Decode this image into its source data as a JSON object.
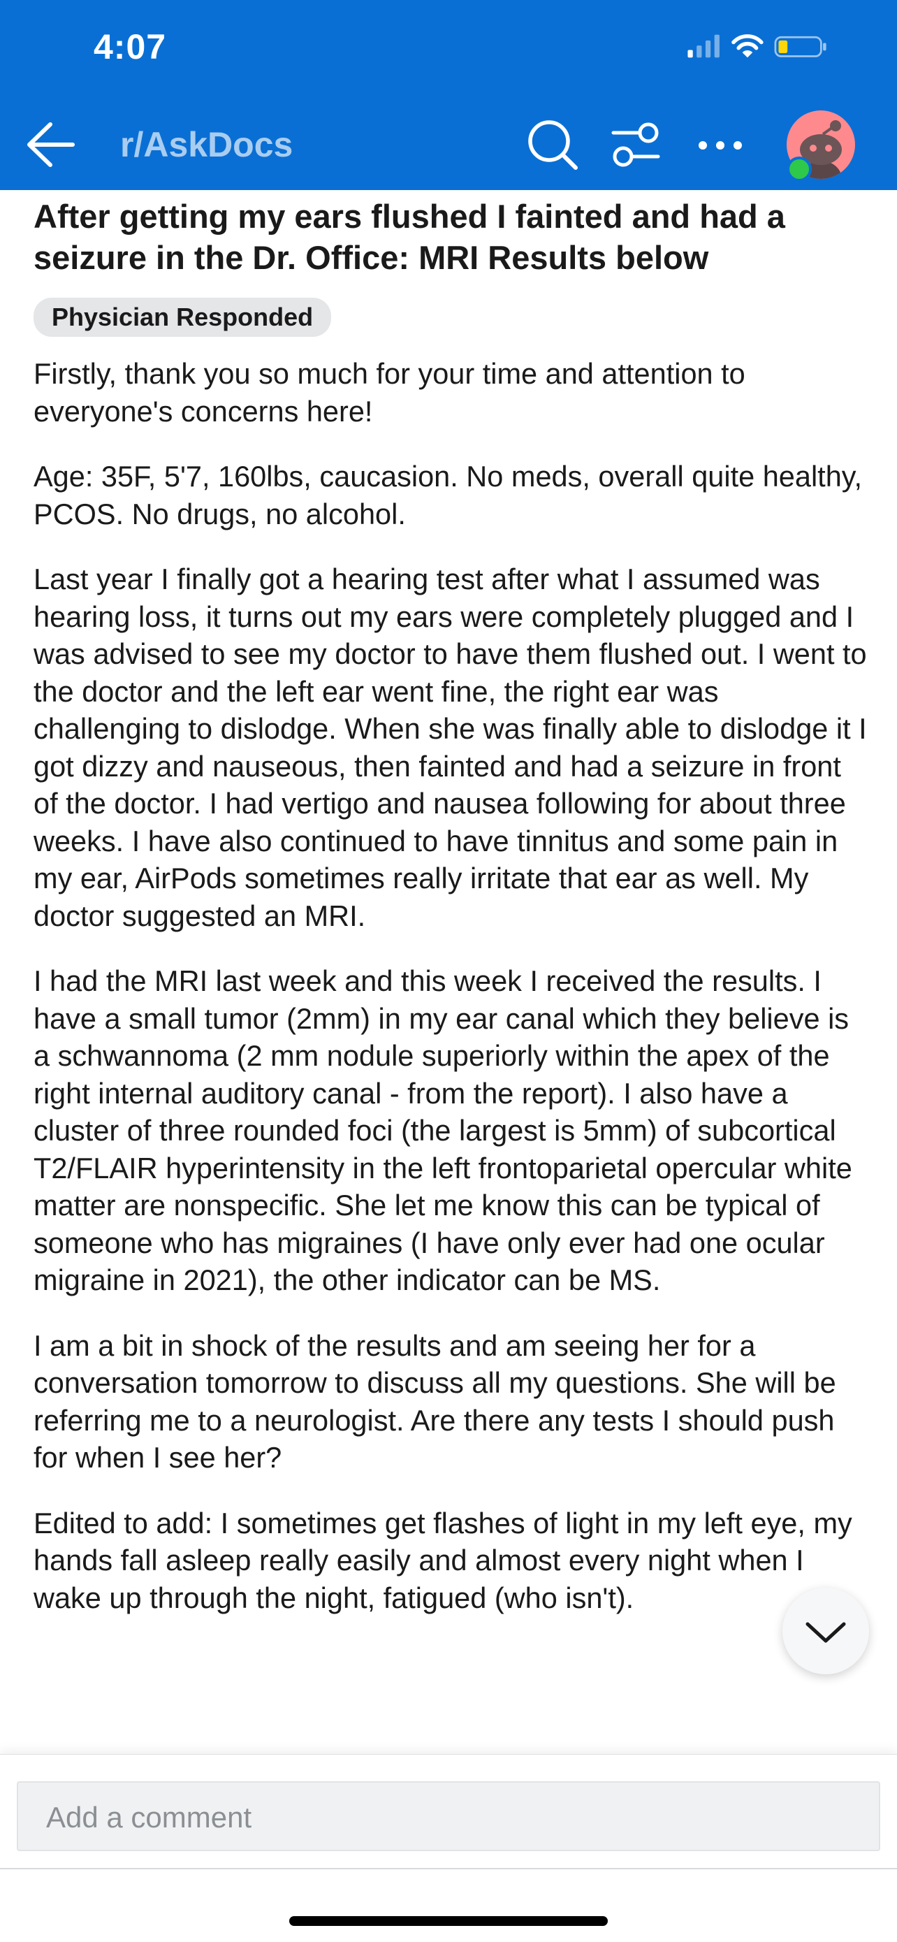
{
  "status_bar": {
    "time": "4:07"
  },
  "nav": {
    "title": "r/AskDocs",
    "icons": [
      "back-arrow-icon",
      "search-icon",
      "filter-icon",
      "more-icon",
      "avatar"
    ]
  },
  "post": {
    "title": "After getting my ears flushed I fainted and had a seizure in the Dr. Office: MRI Results below",
    "flair": "Physician Responded",
    "paragraphs": [
      "Firstly, thank you so much for your time and attention to everyone's concerns here!",
      "Age: 35F, 5'7, 160lbs, caucasion. No meds, overall quite healthy, PCOS. No drugs, no alcohol.",
      "Last year I finally got a hearing test after what I assumed was hearing loss, it turns out my ears were completely plugged and I was advised to see my doctor to have them flushed out. I went to the doctor and the left ear went fine, the right ear was challenging to dislodge. When she was finally able to dislodge it I got dizzy and nauseous, then fainted and had a seizure in front of the doctor. I had vertigo and nausea following for about three weeks. I have also continued to have tinnitus and some pain in my ear, AirPods sometimes really irritate that ear as well. My doctor suggested an MRI.",
      "I had the MRI last week and this week I received the results. I have a small tumor (2mm) in my ear canal which they believe is a schwannoma (2 mm nodule superiorly within the apex of the right internal auditory canal - from the report). I also have a cluster of three rounded foci (the largest is 5mm) of subcortical T2/FLAIR hyperintensity in the left frontoparietal opercular white matter are nonspecific. She let me know this can be typical of someone who has migraines (I have only ever had one ocular migraine in 2021), the other indicator can be MS.",
      "I am a bit in shock of the results and am seeing her for a conversation tomorrow to discuss all my questions. She will be referring me to a neurologist. Are there any tests I should push for when I see her?",
      "Edited to add: I sometimes get flashes of light in my left eye, my hands fall asleep really easily and almost every night when I wake up through the night, fatigued (who isn't)."
    ]
  },
  "comment_bar": {
    "placeholder": "Add a comment"
  },
  "colors": {
    "header": "#0a6fd4",
    "avatar_bg": "#ff8a8e",
    "online": "#2ec84b"
  }
}
